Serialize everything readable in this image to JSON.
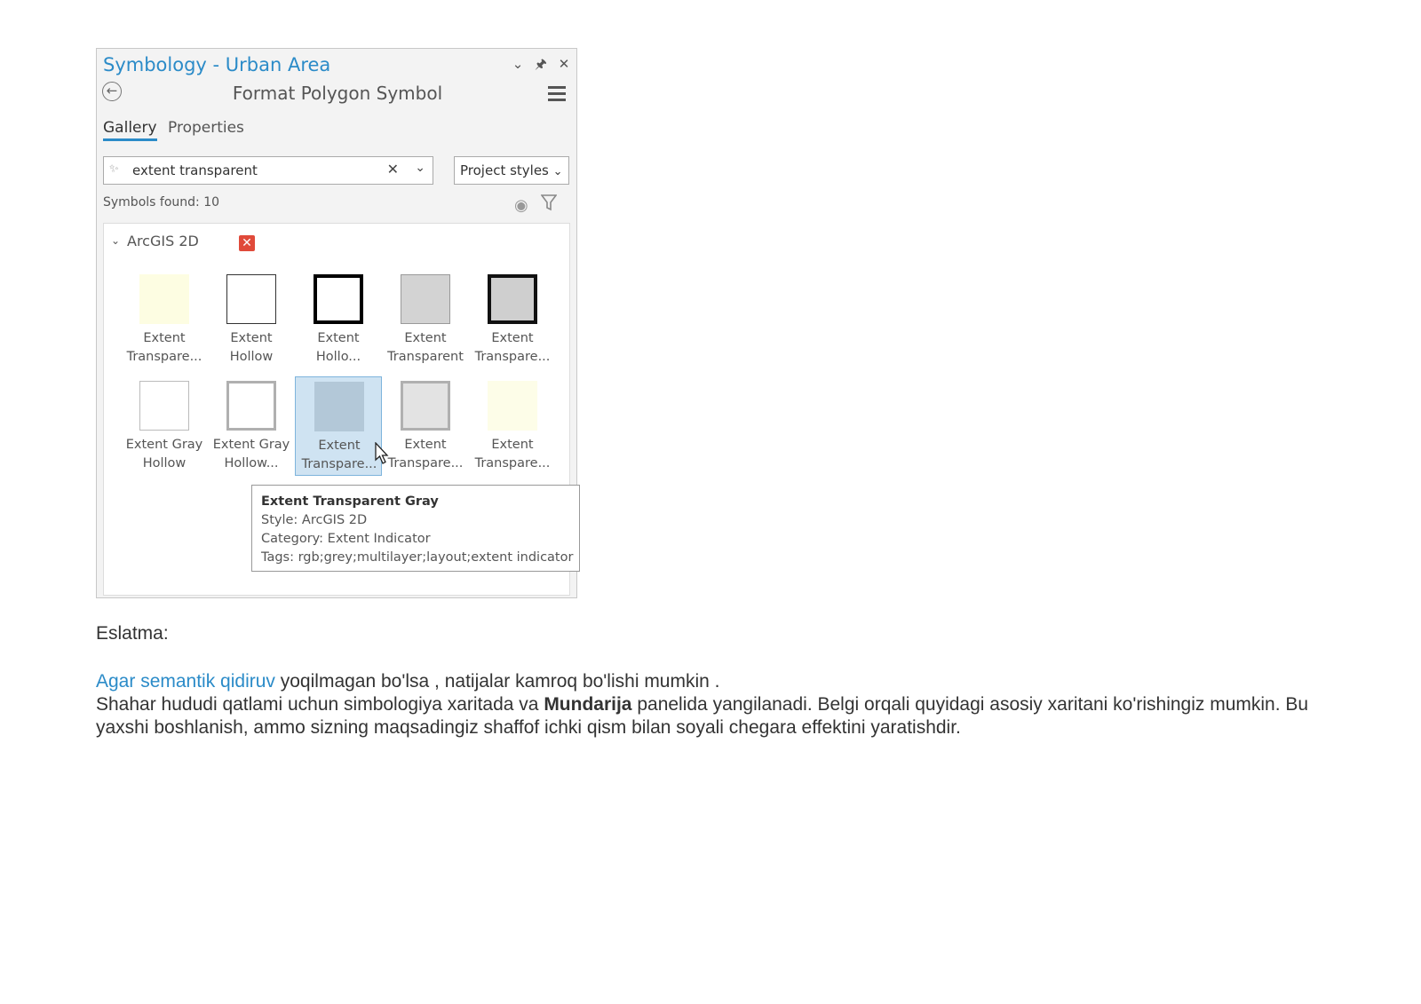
{
  "pane": {
    "title": "Symbology - Urban Area",
    "header": "Format Polygon Symbol",
    "tabs": [
      {
        "label": "Gallery",
        "active": true
      },
      {
        "label": "Properties",
        "active": false
      }
    ],
    "search": {
      "value": "extent transparent"
    },
    "styles_select": "Project styles",
    "symbols_found": "Symbols found: 10",
    "group_label": "ArcGIS 2D",
    "symbols": [
      {
        "line1": "Extent",
        "line2": "Transpare...",
        "fill": "#fdfde2",
        "stroke": "#fdfde2",
        "stroke_w": 1
      },
      {
        "line1": "Extent",
        "line2": "Hollow",
        "fill": "#ffffff",
        "stroke": "#333333",
        "stroke_w": 1
      },
      {
        "line1": "Extent",
        "line2": "Hollo...",
        "fill": "#ffffff",
        "stroke": "#000000",
        "stroke_w": 4
      },
      {
        "line1": "Extent",
        "line2": "Transparent",
        "fill": "#d3d3d3",
        "stroke": "#9a9a9a",
        "stroke_w": 1
      },
      {
        "line1": "Extent",
        "line2": "Transpare...",
        "fill": "#cfcfcf",
        "stroke": "#111111",
        "stroke_w": 4
      },
      {
        "line1": "Extent Gray",
        "line2": "Hollow",
        "fill": "#ffffff",
        "stroke": "#bbbbbb",
        "stroke_w": 1
      },
      {
        "line1": "Extent Gray",
        "line2": "Hollow...",
        "fill": "#ffffff",
        "stroke": "#b0b0b0",
        "stroke_w": 3
      },
      {
        "line1": "Extent",
        "line2": "Transpare...",
        "fill": "#b3c8d8",
        "stroke": "#b3c8d8",
        "stroke_w": 1,
        "selected": true
      },
      {
        "line1": "Extent",
        "line2": "Transpare...",
        "fill": "#e3e3e3",
        "stroke": "#b0b0b0",
        "stroke_w": 3
      },
      {
        "line1": "Extent",
        "line2": "Transpare...",
        "fill": "#fdfde8",
        "stroke": "#fdfde8",
        "stroke_w": 1
      }
    ],
    "tooltip": {
      "title": "Extent Transparent Gray",
      "style": "Style: ArcGIS 2D",
      "category": "Category: Extent Indicator",
      "tags": "Tags: rgb;grey;multilayer;layout;extent indicator"
    }
  },
  "note": {
    "label": "Eslatma:",
    "link_text": "Agar semantik qidiruv",
    "line1_rest": " yoqilmagan bo'lsa , natijalar kamroq bo'lishi mumkin .",
    "line2_a": "Shahar hududi qatlami uchun simbologiya xaritada va ",
    "line2_bold": "Mundarija",
    "line2_b": " panelida yangilanadi. Belgi orqali quyidagi asosiy xaritani ko'rishingiz mumkin. Bu yaxshi boshlanish, ammo sizning maqsadingiz shaffof ichki qism bilan soyali chegara effektini yaratishdir."
  }
}
